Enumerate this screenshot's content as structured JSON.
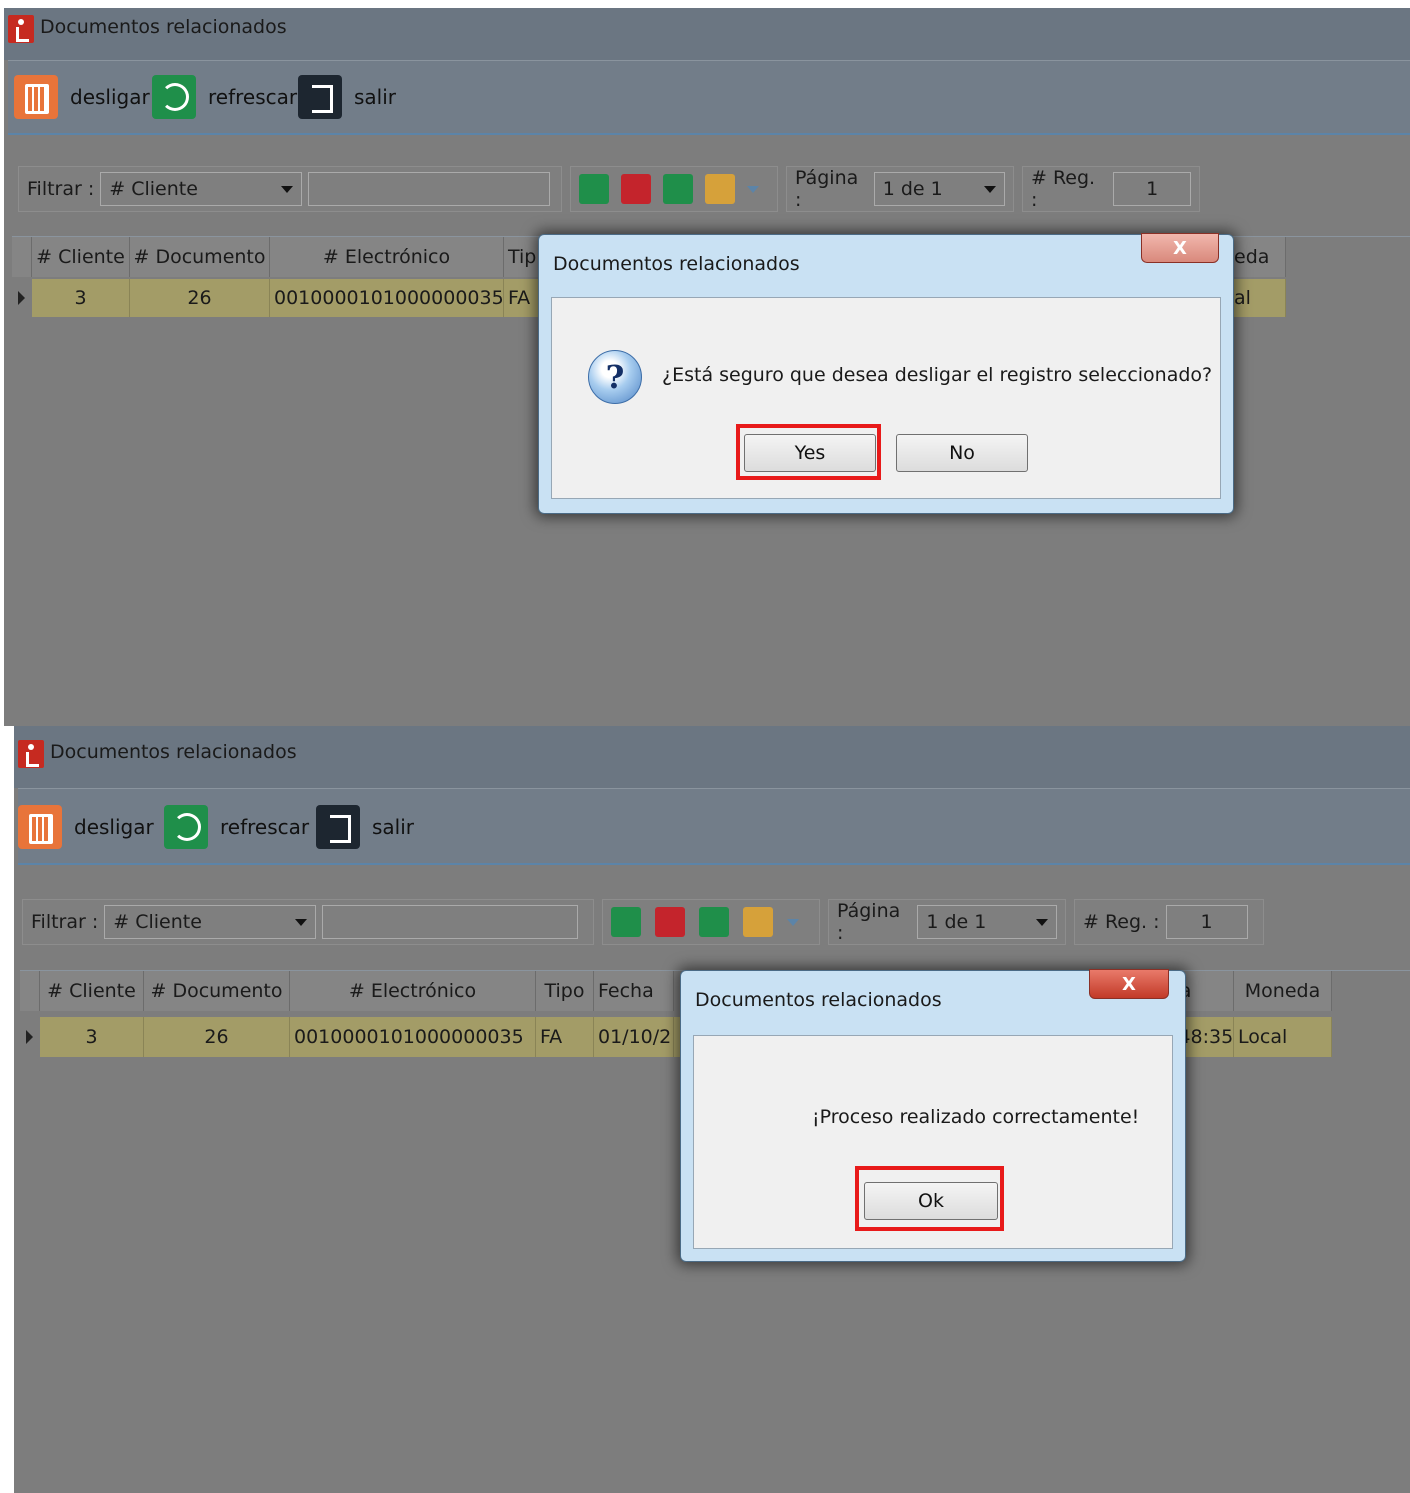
{
  "window_title": "Documentos relacionados",
  "toolbar": {
    "unlink": "desligar",
    "refresh": "refrescar",
    "exit": "salir"
  },
  "filter": {
    "label": "Filtrar :",
    "field": "# Cliente",
    "page_label": "Página :",
    "page_value": "1 de 1",
    "reg_label": "# Reg. :",
    "reg_value": "1"
  },
  "grid_top": {
    "columns": [
      "# Cliente",
      "# Documento",
      "# Electrónico",
      "Tip",
      "eda"
    ],
    "row": [
      "3",
      "26",
      "0010000101000000035",
      "FA",
      "al"
    ]
  },
  "grid_bottom": {
    "columns": [
      "# Cliente",
      "# Documento",
      "# Electrónico",
      "Tipo",
      "Fecha",
      "ra",
      "Moneda"
    ],
    "row": [
      "3",
      "26",
      "0010000101000000035",
      "FA",
      "01/10/2",
      ":48:35",
      "Local"
    ]
  },
  "dialog_confirm": {
    "title": "Documentos relacionados",
    "close": "X",
    "message": "¿Está seguro que desea desligar el registro seleccionado?",
    "yes": "Yes",
    "no": "No"
  },
  "dialog_info": {
    "title": "Documentos relacionados",
    "close": "X",
    "message": "¡Proceso realizado correctamente!",
    "ok": "Ok"
  },
  "colors": {
    "highlight": "#e81a1a",
    "row_selected": "#a39c67"
  }
}
